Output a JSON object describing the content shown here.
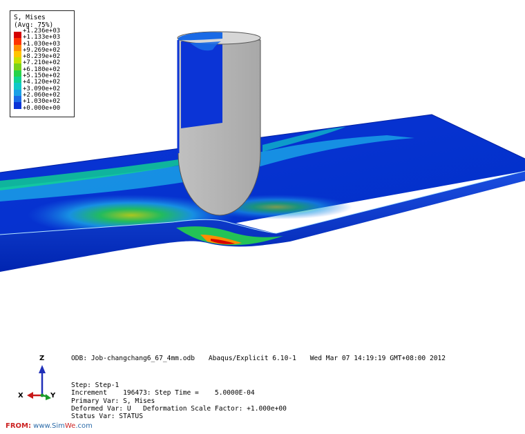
{
  "legend": {
    "title": "S, Mises",
    "subtitle": "(Avg: 75%)",
    "values": [
      "+1.236e+03",
      "+1.133e+03",
      "+1.030e+03",
      "+9.269e+02",
      "+8.239e+02",
      "+7.210e+02",
      "+6.180e+02",
      "+5.150e+02",
      "+4.120e+02",
      "+3.090e+02",
      "+2.060e+02",
      "+1.030e+02",
      "+0.000e+00"
    ],
    "colors": [
      "#d40000",
      "#ff3300",
      "#ff8c00",
      "#ffc400",
      "#c8e000",
      "#7ad21a",
      "#27d34a",
      "#11d490",
      "#10c8c8",
      "#1aa0e6",
      "#1a6ae6",
      "#0b34d6",
      "#0000c8"
    ]
  },
  "info": {
    "odb": "ODB: Job-changchang6_67_4mm.odb",
    "solver": "Abaqus/Explicit 6.10-1",
    "date": "Wed Mar 07 14:19:19 GMT+08:00 2012",
    "step": "Step: Step-1",
    "increment": "Increment    196473: Step Time =    5.0000E-04",
    "primary_var": "Primary Var: S, Mises",
    "deformed_var": "Deformed Var: U   Deformation Scale Factor: +1.000e+00",
    "status_var": "Status Var: STATUS"
  },
  "triad": {
    "z": "Z",
    "x": "X",
    "y": "Y"
  },
  "watermark": {
    "label": "FROM:",
    "site_a": "www.Sim",
    "site_b": "We",
    "site_c": ".com"
  }
}
